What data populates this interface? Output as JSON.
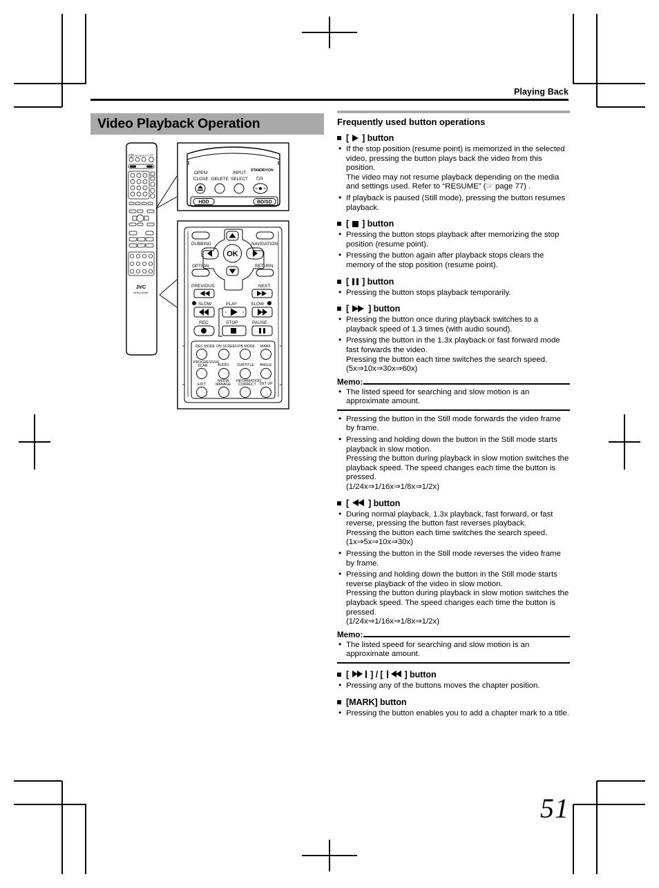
{
  "header": {
    "section_title": "Playing Back"
  },
  "left": {
    "banner_title": "Video Playback Operation"
  },
  "remote": {
    "detail_top": {
      "labels": [
        "OPEN/",
        "CLOSE",
        "DELETE",
        "INPUT",
        "SELECT",
        "STANDBY/ON"
      ],
      "power_glyph": "⏻/I",
      "media_buttons": [
        "HDD",
        "BD/SD"
      ]
    },
    "detail_middle": {
      "nav_labels": [
        "DUBBING",
        "NAVIGATION",
        "OPTION",
        "RETURN",
        "OK"
      ],
      "transport_labels": [
        "PREVIOUS",
        "NEXT",
        "SLOW",
        "PLAY",
        "SLOW",
        "REC",
        "STOP",
        "PAUSE"
      ],
      "function_row1": [
        "REC MODE",
        "ON SCREEN",
        "PB MODE",
        "MARK"
      ],
      "function_row2": [
        "PROGRESSIVE SCAN",
        "AUDIO",
        "SUBTITLE",
        "ANGLE"
      ],
      "function_row3": [
        "EDIT",
        "MEDIA MANAGE",
        "INFORMATION CORRECT",
        "SET UP"
      ]
    },
    "full_remote": {
      "brand": "JVC",
      "model": "BD-RECORDER"
    }
  },
  "right": {
    "heading": "Frequently used button operations",
    "sections": [
      {
        "icon": "play",
        "label_prefix": "[",
        "label_suffix": "] button",
        "bullets": [
          [
            "If the stop position (resume point) is memorized in the selected video, pressing the button plays back the video from this position.",
            "The video may not resume playback depending on the media and settings used. Refer to “RESUME” (☞ page 77) ."
          ],
          [
            "If playback is paused (Still mode), pressing the button resumes playback."
          ]
        ]
      },
      {
        "icon": "stop",
        "label_prefix": "[",
        "label_suffix": "] button",
        "bullets": [
          [
            "Pressing the button stops playback after memorizing the stop position (resume point)."
          ],
          [
            "Pressing the button again after playback stops clears the memory of the stop position (resume point)."
          ]
        ]
      },
      {
        "icon": "pause",
        "label_prefix": "[",
        "label_suffix": "] button",
        "bullets": [
          [
            "Pressing the button stops playback temporarily."
          ]
        ]
      },
      {
        "icon": "fast-forward",
        "label_prefix": "[",
        "label_suffix": "] button",
        "bullets": [
          [
            "Pressing the button once during playback switches to a playback speed of 1.3 times (with audio sound)."
          ],
          [
            "Pressing the button in the 1.3x playback or fast forward mode fast forwards the video.",
            "Pressing the button each time switches the search speed.",
            "(5x⇒10x⇒30x⇒60x)"
          ]
        ],
        "memo": {
          "title": "Memo:",
          "bullets": [
            "The listed speed for searching and slow motion is an approximate amount."
          ]
        },
        "bullets_after": [
          [
            "Pressing the button in the Still mode forwards the video frame by frame."
          ],
          [
            "Pressing and holding down the button in the Still mode starts playback in slow motion.",
            "Pressing the button during playback in slow motion switches the playback speed. The speed changes each time the button is pressed.",
            "(1/24x⇒1/16x⇒1/8x⇒1/2x)"
          ]
        ]
      },
      {
        "icon": "fast-reverse",
        "label_prefix": "[",
        "label_suffix": "] button",
        "bullets": [
          [
            "During normal playback, 1.3x playback, fast forward, or fast reverse, pressing the button fast reverses playback.",
            "Pressing the button each time switches the search speed.",
            "(1x⇒5x⇒10x⇒30x)"
          ],
          [
            "Pressing the button in the Still mode reverses the video frame by frame."
          ],
          [
            "Pressing and holding down the button in the Still mode starts reverse playback of the video in slow motion.",
            "Pressing the button during playback in slow motion switches the playback speed. The speed changes each time the button is pressed.",
            "(1/24x⇒1/16x⇒1/8x⇒1/2x)"
          ]
        ],
        "memo": {
          "title": "Memo:",
          "bullets": [
            "The listed speed for searching and slow motion is an approximate amount."
          ]
        }
      },
      {
        "icon": "chapter-skip",
        "label_prefix": "[",
        "label_mid": "] / [",
        "label_suffix": "] button",
        "bullets": [
          [
            "Pressing any of the buttons moves the chapter position."
          ]
        ]
      },
      {
        "icon": "none",
        "label_text": "[MARK] button",
        "bullets": [
          [
            "Pressing the button enables you to add a chapter mark to a title."
          ]
        ]
      }
    ]
  },
  "page_number": "51",
  "colors": {
    "banner_gray": "#a9a9a9",
    "rule_black": "#000000",
    "page_background": "#ffffff"
  }
}
